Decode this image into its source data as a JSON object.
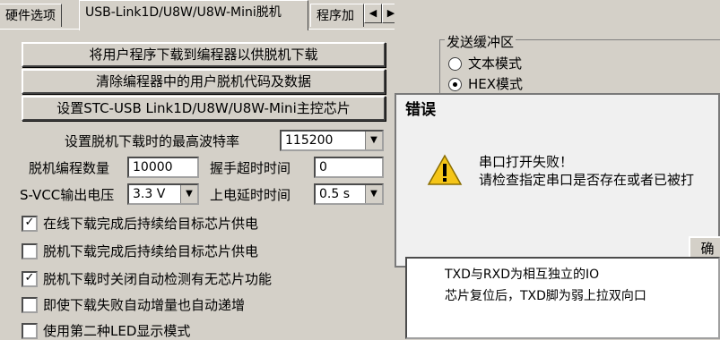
{
  "tabs": [
    {
      "label": "硬件选项"
    },
    {
      "label": "USB-Link1D/U8W/U8W-Mini脱机"
    },
    {
      "label": "程序加"
    }
  ],
  "tab_scroll": {
    "left": "◀",
    "right": "▶"
  },
  "buttons": {
    "download_program": "将用户程序下载到编程器以供脱机下载",
    "clear_program": "清除编程器中的用户脱机代码及数据",
    "set_chip": "设置STC-USB Link1D/U8W/U8W-Mini主控芯片"
  },
  "baud": {
    "label": "设置脱机下载时的最高波特率",
    "value": "115200"
  },
  "count": {
    "label": "脱机编程数量",
    "value": "10000"
  },
  "handshake": {
    "label": "握手超时时间",
    "value": "0"
  },
  "svcc": {
    "label": "S-VCC输出电压",
    "value": "3.3 V"
  },
  "power_delay": {
    "label": "上电延时时间",
    "value": "0.5 s"
  },
  "checkboxes": [
    {
      "label": "在线下载完成后持续给目标芯片供电",
      "checked": true
    },
    {
      "label": "脱机下载完成后持续给目标芯片供电",
      "checked": false
    },
    {
      "label": "脱机下载时关闭自动检测有无芯片功能",
      "checked": true
    },
    {
      "label": "即使下载失败自动增量也自动递增",
      "checked": false
    },
    {
      "label": "使用第二种LED显示模式",
      "checked": false
    }
  ],
  "send_buffer": {
    "title": "发送缓冲区",
    "options": [
      {
        "label": "文本模式",
        "selected": false
      },
      {
        "label": "HEX模式",
        "selected": true
      }
    ]
  },
  "dialog": {
    "title": "错误",
    "line1": "串口打开失败！",
    "line2": "请检查指定串口是否存在或者已被打",
    "button": "确"
  },
  "info_text": [
    "TXD与RXD为相互独立的IO",
    "芯片复位后，TXD脚为弱上拉双向口"
  ],
  "colors": {
    "face": "#d4d0c8",
    "dialog": "#f0f0f0",
    "warning": "#f5c518"
  }
}
